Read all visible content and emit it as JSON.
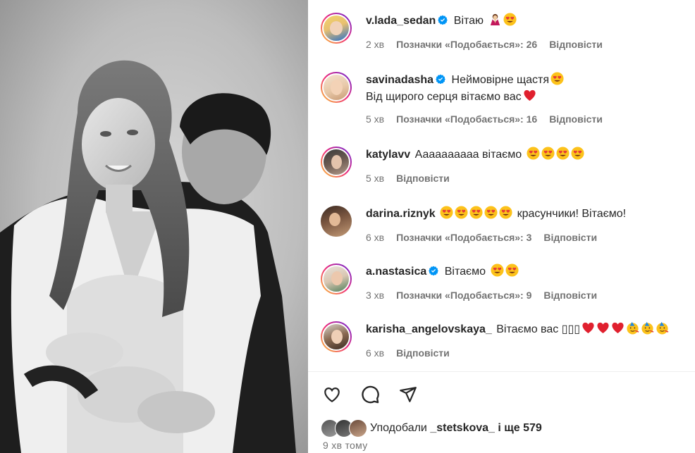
{
  "comments": [
    {
      "username": "v.lada_sedan",
      "verified": true,
      "text": "Вітаю",
      "emojis": [
        "praying-person",
        "heart-eyes"
      ],
      "time": "2 хв",
      "likes": "Позначки «Подобається»: 26",
      "reply": "Відповісти"
    },
    {
      "username": "savinadasha",
      "verified": true,
      "text": "Неймовірне щастя",
      "text2": "Від щирого серця вітаємо вас",
      "emojis": [
        "heart-eyes"
      ],
      "emojis2": [
        "red-heart"
      ],
      "time": "5 хв",
      "likes": "Позначки «Подобається»: 16",
      "reply": "Відповісти"
    },
    {
      "username": "katylavv",
      "verified": false,
      "text": "Аааааааааа вітаємо",
      "emojis": [
        "heart-eyes",
        "heart-eyes",
        "heart-eyes",
        "heart-eyes"
      ],
      "time": "5 хв",
      "likes": "",
      "reply": "Відповісти"
    },
    {
      "username": "darina.riznyk",
      "verified": false,
      "text_pre_emojis": [
        "heart-eyes",
        "heart-eyes",
        "heart-eyes",
        "heart-eyes",
        "heart-eyes"
      ],
      "text": "красунчики! Вітаємо!",
      "time": "6 хв",
      "likes": "Позначки «Подобається»: 3",
      "reply": "Відповісти"
    },
    {
      "username": "a.nastasica",
      "verified": true,
      "text": "Вітаємо",
      "emojis": [
        "heart-eyes",
        "heart-eyes"
      ],
      "time": "3 хв",
      "likes": "Позначки «Подобається»: 9",
      "reply": "Відповісти"
    },
    {
      "username": "karisha_angelovskaya_",
      "verified": false,
      "text": "Вітаємо вас ▯▯▯",
      "emojis": [
        "red-heart",
        "red-heart",
        "red-heart",
        "partying-face",
        "partying-face",
        "partying-face"
      ],
      "time": "6 хв",
      "likes": "",
      "reply": "Відповісти"
    }
  ],
  "actions": {
    "like": "heart-icon",
    "comment": "comment-icon",
    "share": "share-icon"
  },
  "likes_bar": {
    "prefix": "Уподобали",
    "user": "_stetskova_",
    "suffix": "і ще 579"
  },
  "post_time": "9 хв тому",
  "colors": {
    "verified": "#0095f6",
    "meta": "#737373",
    "text": "#262626",
    "ring_start": "#f9ce34",
    "ring_mid": "#ee2a7b",
    "ring_end": "#6228d7"
  }
}
